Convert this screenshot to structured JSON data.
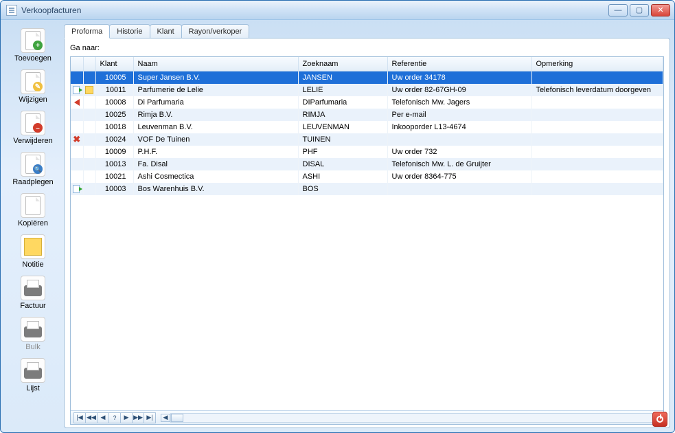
{
  "window": {
    "title": "Verkoopfacturen"
  },
  "sidebar": [
    {
      "id": "toevoegen",
      "label": "Toevoegen",
      "icon": "doc-add"
    },
    {
      "id": "wijzigen",
      "label": "Wijzigen",
      "icon": "doc-edit"
    },
    {
      "id": "verwijderen",
      "label": "Verwijderen",
      "icon": "doc-del"
    },
    {
      "id": "raadplegen",
      "label": "Raadplegen",
      "icon": "doc-view"
    },
    {
      "id": "kopieren",
      "label": "Kopiëren",
      "icon": "doc-copy"
    },
    {
      "id": "notitie",
      "label": "Notitie",
      "icon": "note"
    },
    {
      "id": "factuur",
      "label": "Factuur",
      "icon": "printer"
    },
    {
      "id": "bulk",
      "label": "Bulk",
      "icon": "printer",
      "disabled": true
    },
    {
      "id": "lijst",
      "label": "Lijst",
      "icon": "printer"
    }
  ],
  "tabs": {
    "active": 0,
    "items": [
      {
        "label": "Proforma"
      },
      {
        "label": "Historie"
      },
      {
        "label": "Klant"
      },
      {
        "label": "Rayon/verkoper"
      }
    ]
  },
  "ga_naar_label": "Ga naar:",
  "columns": {
    "klant": "Klant",
    "naam": "Naam",
    "zoeknaam": "Zoeknaam",
    "referentie": "Referentie",
    "opmerking": "Opmerking"
  },
  "rows": [
    {
      "klant": "10005",
      "naam": "Super Jansen B.V.",
      "zoek": "JANSEN",
      "ref": "Uw order 34178",
      "opm": "",
      "ic1": "",
      "ic2": "",
      "selected": true
    },
    {
      "klant": "10011",
      "naam": "Parfumerie de Lelie",
      "zoek": "LELIE",
      "ref": "Uw order 82-67GH-09",
      "opm": "Telefonisch leverdatum doorgeven",
      "ic1": "doc-arrow",
      "ic2": "note"
    },
    {
      "klant": "10008",
      "naam": "Di Parfumaria",
      "zoek": "DIParfumaria",
      "ref": "Telefonisch Mw. Jagers",
      "opm": "",
      "ic1": "arrow-red",
      "ic2": ""
    },
    {
      "klant": "10025",
      "naam": "Rimja B.V.",
      "zoek": "RIMJA",
      "ref": "Per e-mail",
      "opm": "",
      "ic1": "",
      "ic2": ""
    },
    {
      "klant": "10018",
      "naam": "Leuvenman B.V.",
      "zoek": "LEUVENMAN",
      "ref": "Inkooporder L13-4674",
      "opm": "",
      "ic1": "",
      "ic2": ""
    },
    {
      "klant": "10024",
      "naam": "VOF De Tuinen",
      "zoek": "TUINEN",
      "ref": "",
      "opm": "",
      "ic1": "x",
      "ic2": ""
    },
    {
      "klant": "10009",
      "naam": "P.H.F.",
      "zoek": "PHF",
      "ref": "Uw order 732",
      "opm": "",
      "ic1": "",
      "ic2": ""
    },
    {
      "klant": "10013",
      "naam": "Fa. Disal",
      "zoek": "DISAL",
      "ref": "Telefonisch Mw. L. de Gruijter",
      "opm": "",
      "ic1": "",
      "ic2": ""
    },
    {
      "klant": "10021",
      "naam": "Ashi Cosmectica",
      "zoek": "ASHI",
      "ref": "Uw order 8364-775",
      "opm": "",
      "ic1": "",
      "ic2": ""
    },
    {
      "klant": "10003",
      "naam": "Bos Warenhuis B.V.",
      "zoek": "BOS",
      "ref": "",
      "opm": "",
      "ic1": "doc-arrow",
      "ic2": ""
    }
  ],
  "nav_buttons": [
    "|◀",
    "◀◀",
    "◀",
    "?",
    "▶",
    "▶▶",
    "▶|"
  ]
}
